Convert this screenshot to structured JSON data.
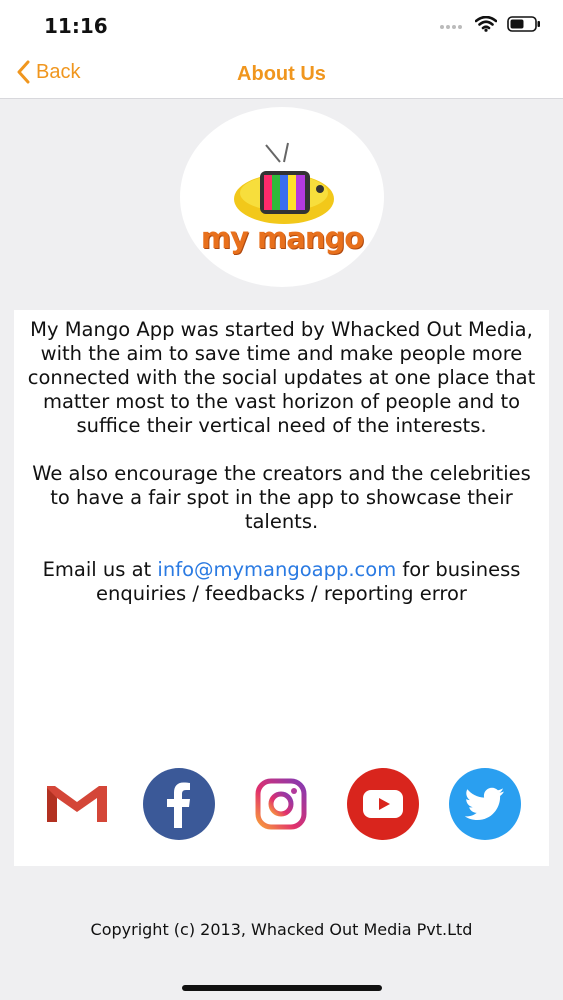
{
  "status_bar": {
    "time": "11:16"
  },
  "nav": {
    "back_label": "Back",
    "title": "About Us"
  },
  "logo": {
    "wordmark": "my mango"
  },
  "about": {
    "paragraph1": "My Mango App was started by Whacked Out Media, with the aim to save time and make people more connected with the social updates at one place that matter most to the vast horizon of people and to suffice their vertical need of the interests.",
    "paragraph2": "We also encourage the creators and the celebrities to have a fair spot in the app to showcase their talents.",
    "email_prefix": "Email us at",
    "email": "info@mymangoapp.com",
    "email_suffix": "for business enquiries / feedbacks /  reporting error"
  },
  "social": [
    {
      "name": "gmail",
      "icon": "gmail-icon",
      "color": "#d44638"
    },
    {
      "name": "facebook",
      "icon": "facebook-icon",
      "color": "#3b5998"
    },
    {
      "name": "instagram",
      "icon": "instagram-icon",
      "color": "#c13584"
    },
    {
      "name": "youtube",
      "icon": "youtube-icon",
      "color": "#d9251d"
    },
    {
      "name": "twitter",
      "icon": "twitter-icon",
      "color": "#2a9ff0"
    }
  ],
  "footer": {
    "copyright": "Copyright (c) 2013, Whacked Out Media Pvt.Ltd"
  },
  "colors": {
    "accent": "#f0961e",
    "link": "#2a7ae2",
    "background": "#efeff1"
  }
}
